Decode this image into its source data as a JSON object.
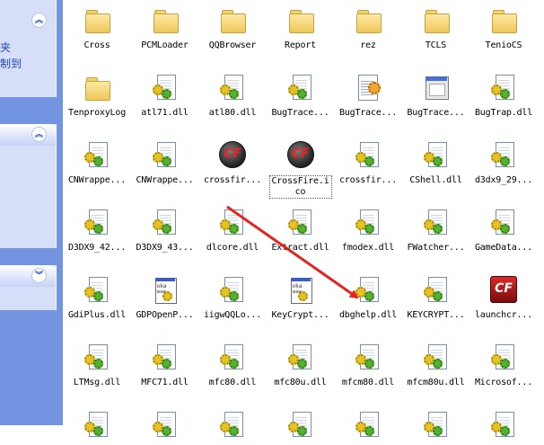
{
  "taskpane": {
    "panel1_lines": [
      "夹",
      "制到"
    ],
    "panel1_toggle": "︽",
    "panel2_toggle": "︽",
    "panel3_toggle": "︾"
  },
  "files": [
    {
      "name": "Cross",
      "type": "folder"
    },
    {
      "name": "PCMLoader",
      "type": "folder"
    },
    {
      "name": "QQBrowser",
      "type": "folder"
    },
    {
      "name": "Report",
      "type": "folder"
    },
    {
      "name": "rez",
      "type": "folder"
    },
    {
      "name": "TCLS",
      "type": "folder"
    },
    {
      "name": "TenioCS",
      "type": "folder"
    },
    {
      "name": "TenproxyLog",
      "type": "folder"
    },
    {
      "name": "atl71.dll",
      "type": "dll"
    },
    {
      "name": "atl80.dll",
      "type": "dll"
    },
    {
      "name": "BugTrace...",
      "type": "dll"
    },
    {
      "name": "BugTrace...",
      "type": "gen"
    },
    {
      "name": "BugTrace...",
      "type": "exe"
    },
    {
      "name": "BugTrap.dll",
      "type": "dll"
    },
    {
      "name": "CNWrappe...",
      "type": "dll"
    },
    {
      "name": "CNWrappe...",
      "type": "dll"
    },
    {
      "name": "crossfir...",
      "type": "cf"
    },
    {
      "name": "CrossFire.ico",
      "type": "cf",
      "selected": true
    },
    {
      "name": "crossfir...",
      "type": "dll"
    },
    {
      "name": "CShell.dll",
      "type": "dll"
    },
    {
      "name": "d3dx9_29...",
      "type": "dll"
    },
    {
      "name": "D3DX9_42...",
      "type": "dll"
    },
    {
      "name": "D3DX9_43...",
      "type": "dll"
    },
    {
      "name": "dlcore.dll",
      "type": "dll"
    },
    {
      "name": "Extract.dll",
      "type": "dll"
    },
    {
      "name": "fmodex.dll",
      "type": "dll"
    },
    {
      "name": "FWatcher...",
      "type": "dll"
    },
    {
      "name": "GameData...",
      "type": "dll"
    },
    {
      "name": "GdiPlus.dll",
      "type": "dll"
    },
    {
      "name": "GDPOpenP...",
      "type": "win"
    },
    {
      "name": "iigwQQLo...",
      "type": "dll"
    },
    {
      "name": "KeyCrypt...",
      "type": "win"
    },
    {
      "name": "dbghelp.dll",
      "type": "dll"
    },
    {
      "name": "KEYCRYPT...",
      "type": "dll"
    },
    {
      "name": "launchcr...",
      "type": "cfsq"
    },
    {
      "name": "LTMsg.dll",
      "type": "dll"
    },
    {
      "name": "MFC71.dll",
      "type": "dll"
    },
    {
      "name": "mfc80.dll",
      "type": "dll"
    },
    {
      "name": "mfc80u.dll",
      "type": "dll"
    },
    {
      "name": "mfcm80.dll",
      "type": "dll"
    },
    {
      "name": "mfcm80u.dll",
      "type": "dll"
    },
    {
      "name": "Microsof...",
      "type": "dll"
    },
    {
      "name": "",
      "type": "dll"
    },
    {
      "name": "",
      "type": "dll"
    },
    {
      "name": "",
      "type": "dll"
    },
    {
      "name": "",
      "type": "dll"
    },
    {
      "name": "",
      "type": "dll"
    },
    {
      "name": "",
      "type": "dll"
    },
    {
      "name": "",
      "type": "dll"
    }
  ],
  "colors": {
    "arrow": "#e8211c",
    "pane_bg": "#7394e0",
    "pane_panel": "#d6dff7",
    "pane_text": "#2148b8"
  }
}
